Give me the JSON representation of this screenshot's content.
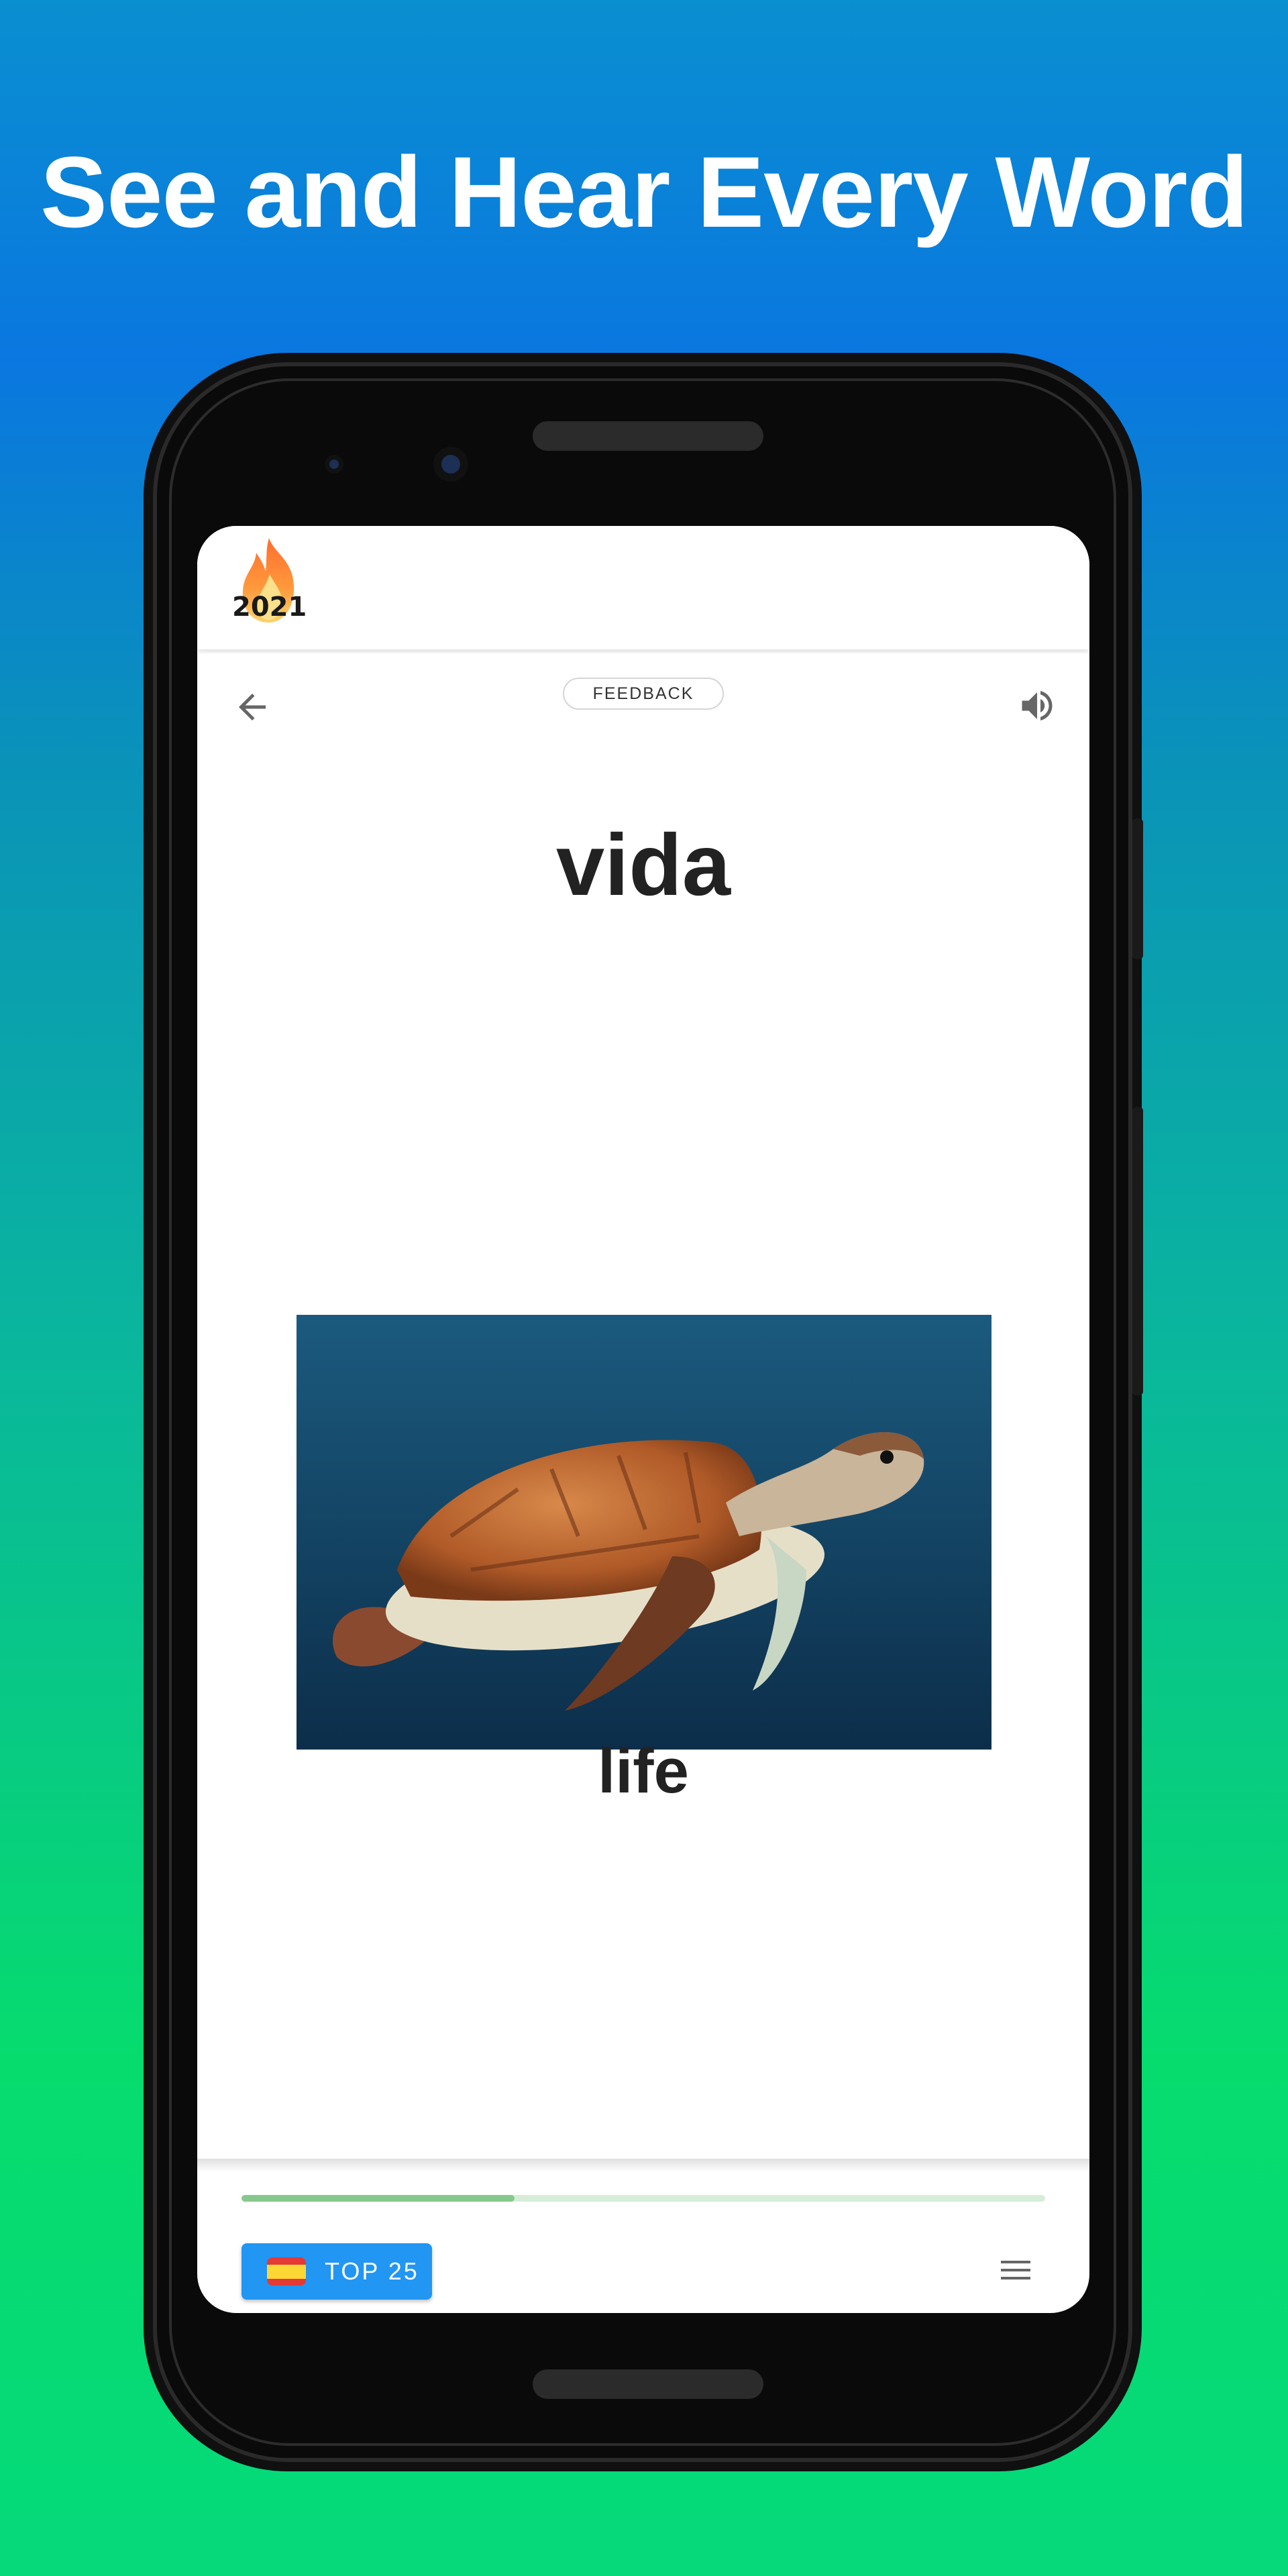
{
  "headline": "See and Hear Every Word",
  "header": {
    "badge_year": "2021"
  },
  "card": {
    "feedback_label": "FEEDBACK",
    "word": "vida",
    "translation": "life",
    "image_alt": "sea turtle swimming"
  },
  "progress": {
    "fraction": 0.34
  },
  "footer": {
    "deck_label": "TOP 25",
    "deck_flag": "spain-flag-icon"
  },
  "colors": {
    "accent_blue": "#2196f3",
    "progress_fill": "#86c98c",
    "progress_track": "#d6eed8",
    "text": "#222222"
  }
}
